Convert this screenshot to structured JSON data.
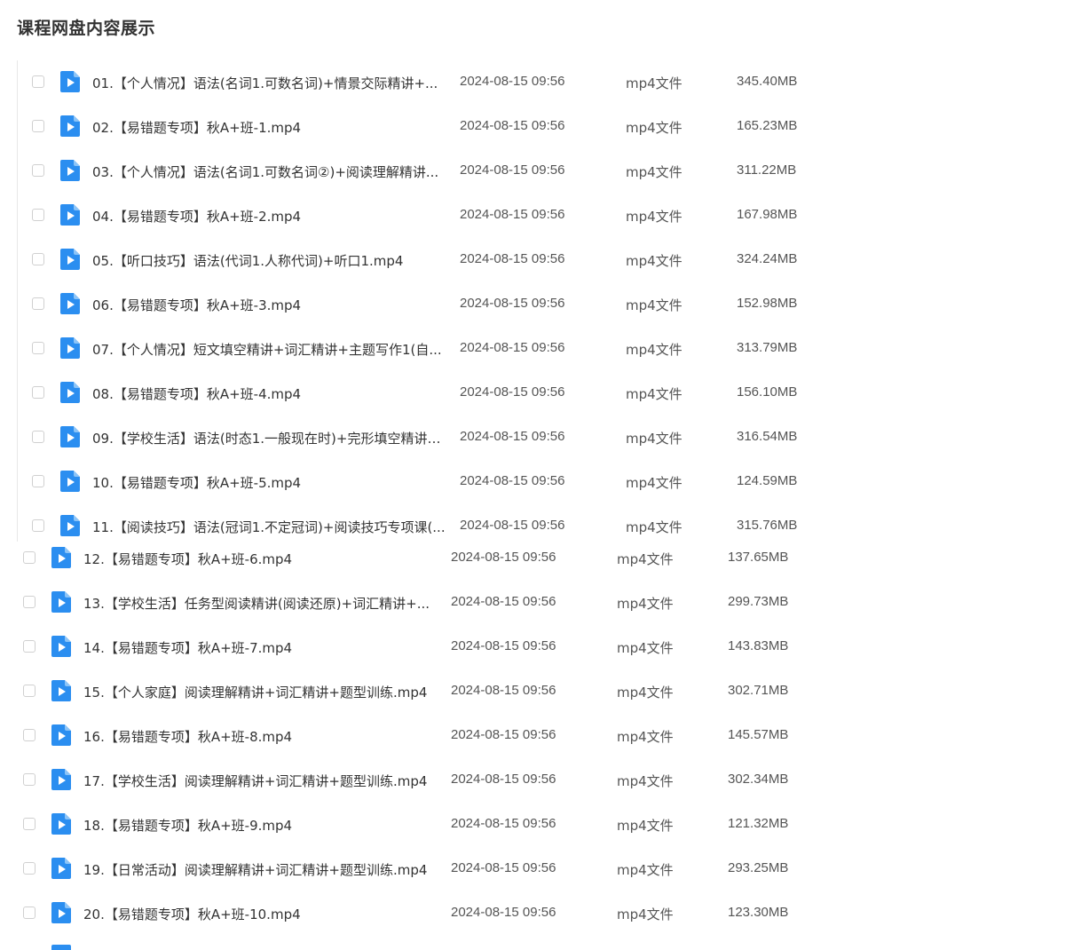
{
  "page": {
    "title": "课程网盘内容展示"
  },
  "colors": {
    "accent": "#2b8ef0",
    "text": "#333333",
    "muted": "#555555"
  },
  "icons": {
    "file": "video-file-icon",
    "checkbox": "checkbox-icon"
  },
  "files": [
    {
      "name": "01.【个人情况】语法(名词1.可数名词)+情景交际精讲+...",
      "date": "2024-08-15 09:56",
      "type": "mp4文件",
      "size": "345.40MB"
    },
    {
      "name": "02.【易错题专项】秋A+班-1.mp4",
      "date": "2024-08-15 09:56",
      "type": "mp4文件",
      "size": "165.23MB"
    },
    {
      "name": "03.【个人情况】语法(名词1.可数名词②)+阅读理解精讲...",
      "date": "2024-08-15 09:56",
      "type": "mp4文件",
      "size": "311.22MB"
    },
    {
      "name": "04.【易错题专项】秋A+班-2.mp4",
      "date": "2024-08-15 09:56",
      "type": "mp4文件",
      "size": "167.98MB"
    },
    {
      "name": "05.【听口技巧】语法(代词1.人称代词)+听口1.mp4",
      "date": "2024-08-15 09:56",
      "type": "mp4文件",
      "size": "324.24MB"
    },
    {
      "name": "06.【易错题专项】秋A+班-3.mp4",
      "date": "2024-08-15 09:56",
      "type": "mp4文件",
      "size": "152.98MB"
    },
    {
      "name": "07.【个人情况】短文填空精讲+词汇精讲+主题写作1(自...",
      "date": "2024-08-15 09:56",
      "type": "mp4文件",
      "size": "313.79MB"
    },
    {
      "name": "08.【易错题专项】秋A+班-4.mp4",
      "date": "2024-08-15 09:56",
      "type": "mp4文件",
      "size": "156.10MB"
    },
    {
      "name": "09.【学校生活】语法(时态1.一般现在时)+完形填空精讲+...",
      "date": "2024-08-15 09:56",
      "type": "mp4文件",
      "size": "316.54MB"
    },
    {
      "name": "10.【易错题专项】秋A+班-5.mp4",
      "date": "2024-08-15 09:56",
      "type": "mp4文件",
      "size": "124.59MB"
    },
    {
      "name": "11.【阅读技巧】语法(冠词1.不定冠词)+阅读技巧专项课(...",
      "date": "2024-08-15 09:56",
      "type": "mp4文件",
      "size": "315.76MB"
    },
    {
      "name": "12.【易错题专项】秋A+班-6.mp4",
      "date": "2024-08-15 09:56",
      "type": "mp4文件",
      "size": "137.65MB"
    },
    {
      "name": "13.【学校生活】任务型阅读精讲(阅读还原)+词汇精讲+...",
      "date": "2024-08-15 09:56",
      "type": "mp4文件",
      "size": "299.73MB"
    },
    {
      "name": "14.【易错题专项】秋A+班-7.mp4",
      "date": "2024-08-15 09:56",
      "type": "mp4文件",
      "size": "143.83MB"
    },
    {
      "name": "15.【个人家庭】阅读理解精讲+词汇精讲+题型训练.mp4",
      "date": "2024-08-15 09:56",
      "type": "mp4文件",
      "size": "302.71MB"
    },
    {
      "name": "16.【易错题专项】秋A+班-8.mp4",
      "date": "2024-08-15 09:56",
      "type": "mp4文件",
      "size": "145.57MB"
    },
    {
      "name": "17.【学校生活】阅读理解精讲+词汇精讲+题型训练.mp4",
      "date": "2024-08-15 09:56",
      "type": "mp4文件",
      "size": "302.34MB"
    },
    {
      "name": "18.【易错题专项】秋A+班-9.mp4",
      "date": "2024-08-15 09:56",
      "type": "mp4文件",
      "size": "121.32MB"
    },
    {
      "name": "19.【日常活动】阅读理解精讲+词汇精讲+题型训练.mp4",
      "date": "2024-08-15 09:56",
      "type": "mp4文件",
      "size": "293.25MB"
    },
    {
      "name": "20.【易错题专项】秋A+班-10.mp4",
      "date": "2024-08-15 09:56",
      "type": "mp4文件",
      "size": "123.30MB"
    }
  ]
}
